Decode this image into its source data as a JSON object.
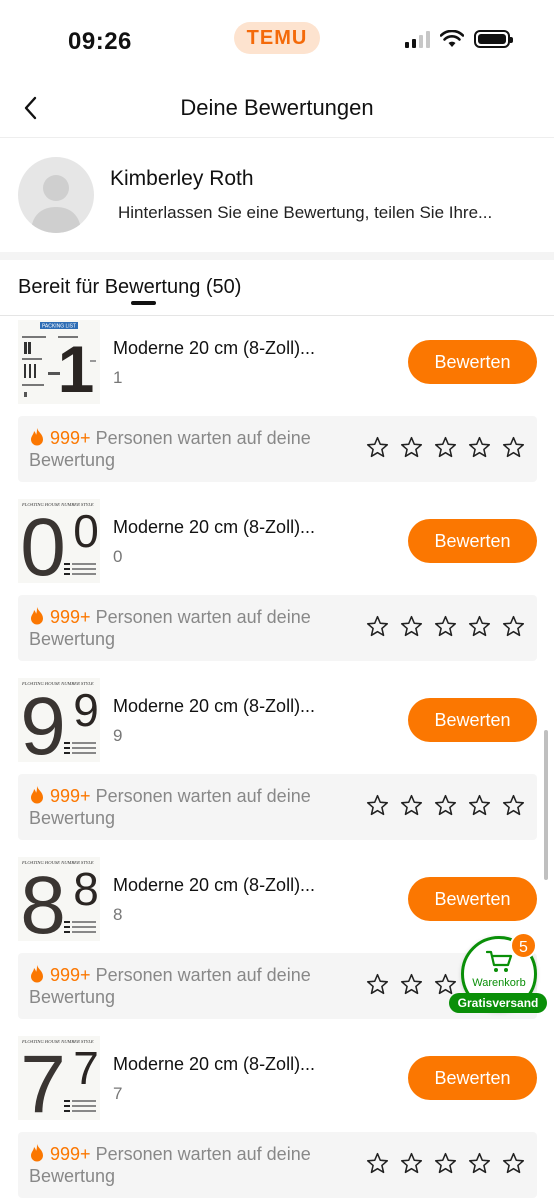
{
  "status_bar": {
    "time": "09:26",
    "app_label": "TEMU"
  },
  "header": {
    "title": "Deine Bewertungen"
  },
  "profile": {
    "name": "Kimberley Roth",
    "prompt": "Hinterlassen Sie eine Bewertung, teilen Sie Ihre..."
  },
  "section": {
    "title": "Bereit für Bewertung (50)"
  },
  "items": [
    {
      "title": "Moderne 20 cm (8-Zoll)...",
      "variant": "1",
      "button": "Bewerten",
      "wait_count": "999+",
      "wait_text": " Personen warten auf deine Bewertung",
      "thumb_digit": "1",
      "thumb_caption": "PACKING LIST",
      "stars": 5
    },
    {
      "title": "Moderne 20 cm (8-Zoll)...",
      "variant": "0",
      "button": "Bewerten",
      "wait_count": "999+",
      "wait_text": " Personen warten auf deine Bewertung",
      "thumb_digit": "0",
      "thumb_caption": "FLOATING HOUSE NUMBER STYLE",
      "stars": 5
    },
    {
      "title": "Moderne 20 cm (8-Zoll)...",
      "variant": "9",
      "button": "Bewerten",
      "wait_count": "999+",
      "wait_text": " Personen warten auf deine Bewertung",
      "thumb_digit": "9",
      "thumb_caption": "FLOATING HOUSE NUMBER STYLE",
      "stars": 5
    },
    {
      "title": "Moderne 20 cm (8-Zoll)...",
      "variant": "8",
      "button": "Bewerten",
      "wait_count": "999+",
      "wait_text": " Personen warten auf deine Bewertung",
      "thumb_digit": "8",
      "thumb_caption": "FLOATING HOUSE NUMBER STYLE",
      "stars": 5
    },
    {
      "title": "Moderne 20 cm (8-Zoll)...",
      "variant": "7",
      "button": "Bewerten",
      "wait_count": "999+",
      "wait_text": " Personen warten auf deine Bewertung",
      "thumb_digit": "7",
      "thumb_caption": "FLOATING HOUSE NUMBER STYLE",
      "stars": 5
    }
  ],
  "cart": {
    "label": "Warenkorb",
    "badge": "5",
    "free_shipping": "Gratisversand"
  },
  "colors": {
    "accent": "#fb7701",
    "green": "#0a8f08",
    "text": "#111111",
    "muted": "#888888"
  },
  "icons": {
    "back": "chevron-left-icon",
    "star": "star-outline-icon",
    "flame": "flame-icon",
    "cart": "shopping-cart-icon"
  }
}
